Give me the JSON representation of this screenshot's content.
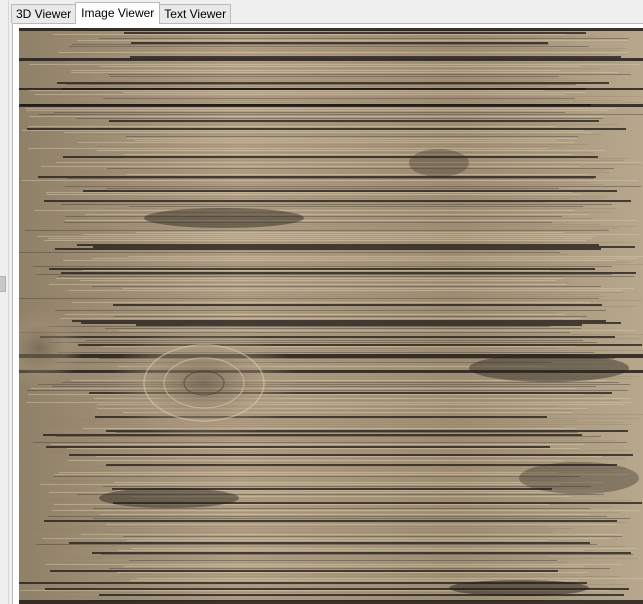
{
  "tabs": [
    {
      "label": "3D Viewer",
      "active": false
    },
    {
      "label": "Image Viewer",
      "active": true
    },
    {
      "label": "Text Viewer",
      "active": false
    }
  ],
  "viewer": {
    "image_description_colors": {
      "base": "#9e8e75",
      "light": "#c9b79c",
      "dark": "#2b2520"
    }
  }
}
